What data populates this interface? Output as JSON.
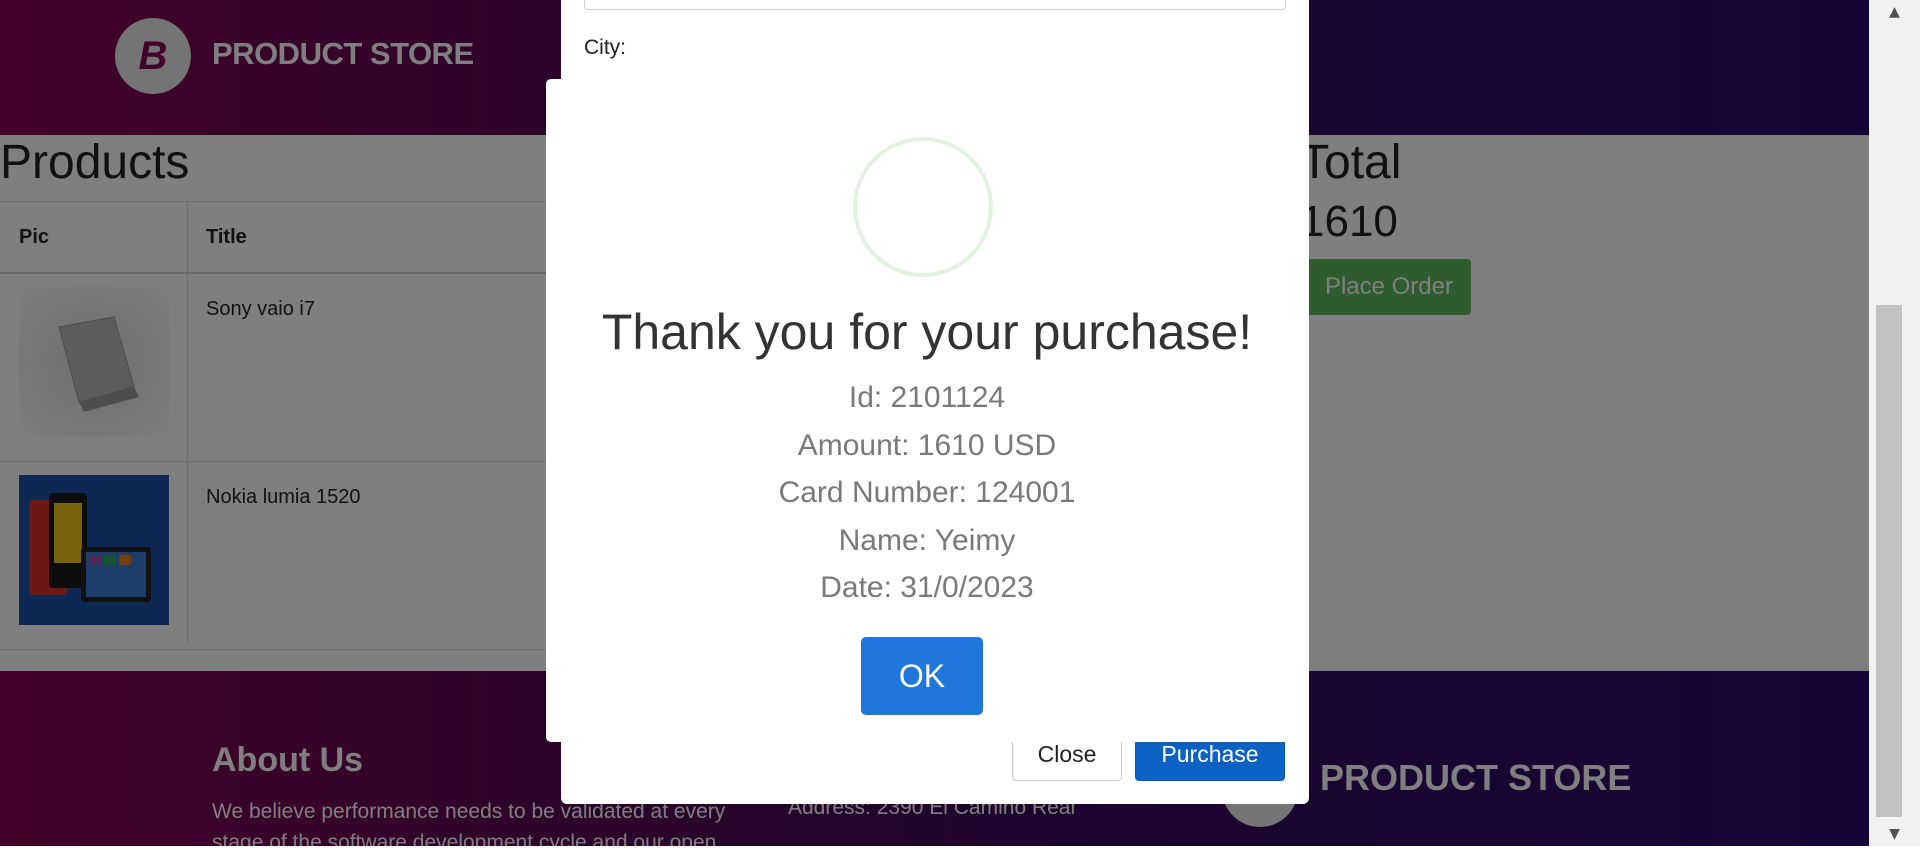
{
  "navbar": {
    "brand": "PRODUCT STORE",
    "logo_letter": "B"
  },
  "cart": {
    "heading": "Products",
    "columns": [
      "Pic",
      "Title"
    ],
    "rows": [
      {
        "title": "Sony vaio i7",
        "image": "laptop"
      },
      {
        "title": "Nokia lumia 1520",
        "image": "phone"
      }
    ],
    "total_heading": "Total",
    "total_value": "1610",
    "place_order_label": "Place Order"
  },
  "order_modal": {
    "city_label": "City:",
    "close_label": "Close",
    "purchase_label": "Purchase"
  },
  "alert": {
    "title": "Thank you for your purchase!",
    "lines": [
      "Id: 2101124",
      "Amount: 1610 USD",
      "Card Number: 124001",
      "Name: Yeimy",
      "Date: 31/0/2023"
    ],
    "ok_label": "OK",
    "icon": "success-check-icon",
    "icon_color": "#e3f2e0",
    "button_color": "#1f76db"
  },
  "footer": {
    "about_title": "About Us",
    "about_text": "We believe performance needs to be validated at every stage of the software development cycle and our open",
    "address": "Address: 2390 El Camino Real",
    "brand": "PRODUCT STORE"
  },
  "colors": {
    "nav_gradient_start": "#850550",
    "nav_gradient_end": "#2a0a6d",
    "place_order": "#5cb85c",
    "purchase": "#0b62c4"
  }
}
